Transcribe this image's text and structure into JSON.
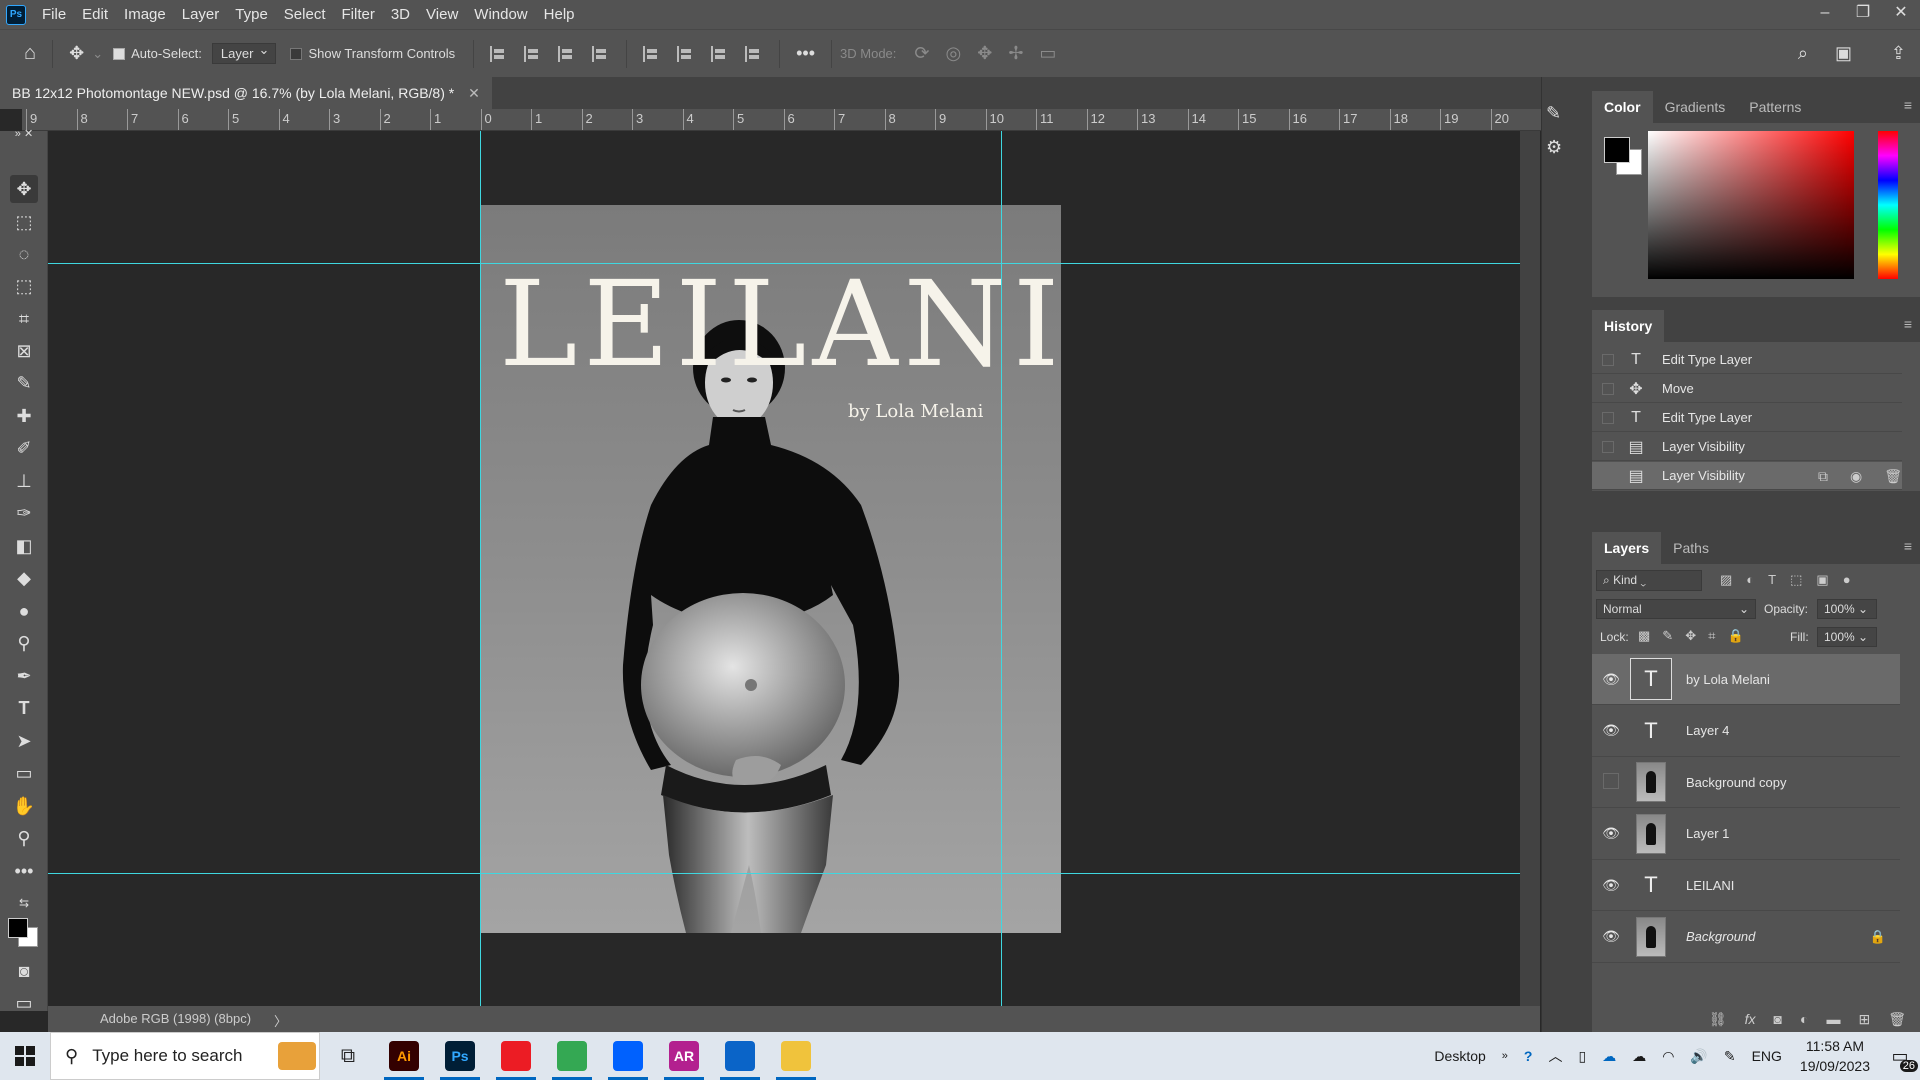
{
  "menu": [
    "File",
    "Edit",
    "Image",
    "Layer",
    "Type",
    "Select",
    "Filter",
    "3D",
    "View",
    "Window",
    "Help"
  ],
  "options": {
    "auto_select_label": "Auto-Select:",
    "auto_select_value": "Layer",
    "transform_label": "Show Transform Controls",
    "mode_3d_label": "3D Mode:"
  },
  "document": {
    "tab_title": "BB 12x12 Photomontage NEW.psd @ 16.7% (by Lola Melani, RGB/8) *",
    "title_text": "LEILANI",
    "subtitle_text": "by Lola Melani",
    "status": "Adobe RGB (1998) (8bpc)"
  },
  "ruler": [
    "9",
    "8",
    "7",
    "6",
    "5",
    "4",
    "3",
    "2",
    "1",
    "0",
    "1",
    "2",
    "3",
    "4",
    "5",
    "6",
    "7",
    "8",
    "9",
    "10",
    "11",
    "12",
    "13",
    "14",
    "15",
    "16",
    "17",
    "18",
    "19",
    "20"
  ],
  "color_panel": {
    "tabs": [
      "Color",
      "Gradients",
      "Patterns"
    ],
    "hue": "#ff0000"
  },
  "history": {
    "title": "History",
    "items": [
      {
        "label": "Edit Type Layer",
        "icon": "T"
      },
      {
        "label": "Move",
        "icon": "✥"
      },
      {
        "label": "Edit Type Layer",
        "icon": "T"
      },
      {
        "label": "Layer Visibility",
        "icon": "▤"
      },
      {
        "label": "Layer Visibility",
        "icon": "▤"
      }
    ]
  },
  "layers": {
    "tabs": [
      "Layers",
      "Paths"
    ],
    "filter_kind": "Kind",
    "blend_mode": "Normal",
    "opacity_label": "Opacity:",
    "opacity": "100%",
    "lock_label": "Lock:",
    "fill_label": "Fill:",
    "fill": "100%",
    "items": [
      {
        "name": "by Lola Melani",
        "type": "text",
        "visible": true,
        "selected": true
      },
      {
        "name": "Layer 4",
        "type": "text",
        "visible": true
      },
      {
        "name": "Background copy",
        "type": "photo",
        "visible": false
      },
      {
        "name": "Layer 1",
        "type": "photo",
        "visible": true
      },
      {
        "name": "LEILANI",
        "type": "text",
        "visible": true
      },
      {
        "name": "Background",
        "type": "photo",
        "visible": true,
        "locked": true
      }
    ]
  },
  "taskbar": {
    "search_placeholder": "Type here to search",
    "desktop_label": "Desktop",
    "lang": "ENG",
    "time": "11:58 AM",
    "date": "19/09/2023",
    "notif_count": "26",
    "apps": [
      {
        "name": "Ai",
        "bg": "#330000",
        "fg": "#ff9a00"
      },
      {
        "name": "Ps",
        "bg": "#001e36",
        "fg": "#31a8ff"
      },
      {
        "name": "Acrobat",
        "bg": "#ec1c24",
        "fg": "#ffffff"
      },
      {
        "name": "Chrome",
        "bg": "#34a853",
        "fg": "#ffffff"
      },
      {
        "name": "Dropbox",
        "bg": "#0061fe",
        "fg": "#ffffff"
      },
      {
        "name": "AR",
        "bg": "#b3208f",
        "fg": "#ffffff"
      },
      {
        "name": "Outlook",
        "bg": "#0a64c8",
        "fg": "#ffffff"
      },
      {
        "name": "Explorer",
        "bg": "#f0c33c",
        "fg": "#6b4a00"
      }
    ]
  }
}
